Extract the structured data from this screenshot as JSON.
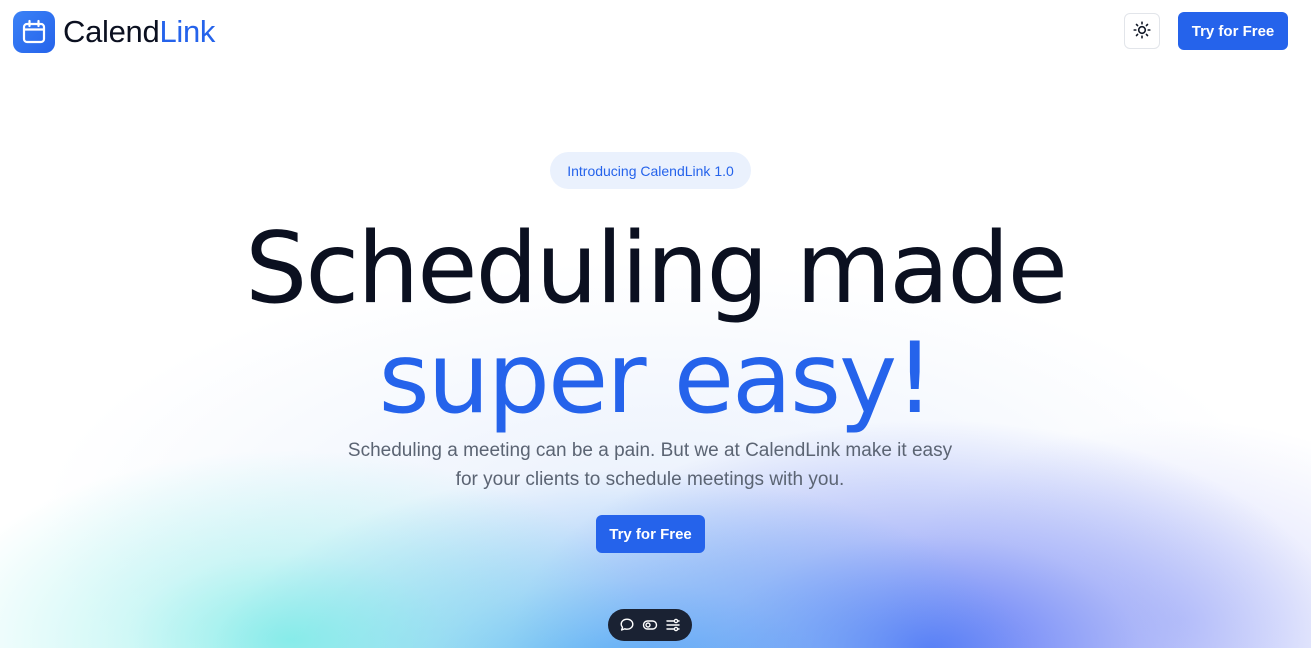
{
  "brand": {
    "name_part1": "Calend",
    "name_part2": "Link",
    "logo_icon": "calendar-icon",
    "accent_color": "#2563eb",
    "text_color": "#0b1020"
  },
  "header": {
    "theme_toggle_icon": "sun-icon",
    "cta_label": "Try for Free"
  },
  "hero": {
    "badge": "Introducing CalendLink 1.0",
    "headline_line1": "Scheduling made",
    "headline_line2": "super easy!",
    "subtext_line1": "Scheduling a meeting can be a pain. But we at CalendLink make it easy",
    "subtext_line2": "for your clients to schedule meetings with you.",
    "cta_label": "Try for Free"
  },
  "toolbar": {
    "icons": [
      "chat-bubble-icon",
      "eye-toggle-icon",
      "sliders-icon"
    ]
  }
}
